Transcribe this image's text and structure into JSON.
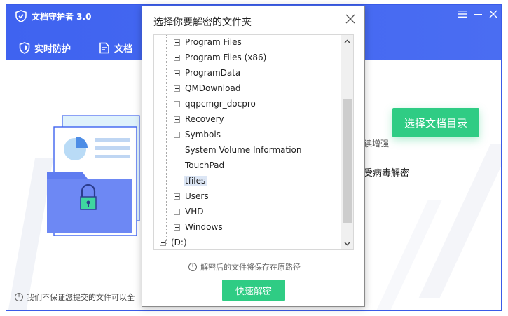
{
  "app": {
    "title": "文档守护者 3.0",
    "tabs": [
      {
        "label": "实时防护",
        "icon": "shield-icon"
      },
      {
        "label": "文档",
        "icon": "document-icon"
      }
    ],
    "window_controls": [
      "menu-icon",
      "minimize-icon",
      "close-icon"
    ]
  },
  "main": {
    "select_dir_button": "选择文档目录",
    "desc_1": "读增强",
    "desc_2": "受病毒解密",
    "disclaimer": "我们不保证您提交的文件可以全"
  },
  "dialog": {
    "title": "选择你要解密的文件夹",
    "tree": [
      {
        "label": "Program Files",
        "expandable": true,
        "level": 1
      },
      {
        "label": "Program Files (x86)",
        "expandable": true,
        "level": 1
      },
      {
        "label": "ProgramData",
        "expandable": true,
        "level": 1
      },
      {
        "label": "QMDownload",
        "expandable": true,
        "level": 1
      },
      {
        "label": "qqpcmgr_docpro",
        "expandable": true,
        "level": 1
      },
      {
        "label": "Recovery",
        "expandable": true,
        "level": 1
      },
      {
        "label": "Symbols",
        "expandable": true,
        "level": 1
      },
      {
        "label": "System Volume Information",
        "expandable": false,
        "level": 1
      },
      {
        "label": "TouchPad",
        "expandable": false,
        "level": 1
      },
      {
        "label": "tfiles",
        "expandable": false,
        "level": 1,
        "selected": true
      },
      {
        "label": "Users",
        "expandable": true,
        "level": 1
      },
      {
        "label": "VHD",
        "expandable": true,
        "level": 1
      },
      {
        "label": "Windows",
        "expandable": true,
        "level": 1
      },
      {
        "label": "(D:)",
        "expandable": true,
        "level": 0
      }
    ],
    "note": "解密后的文件将保存在原路径",
    "confirm_button": "快速解密"
  },
  "colors": {
    "brand_blue": "#4166f0",
    "accent_green": "#2fcc84"
  }
}
